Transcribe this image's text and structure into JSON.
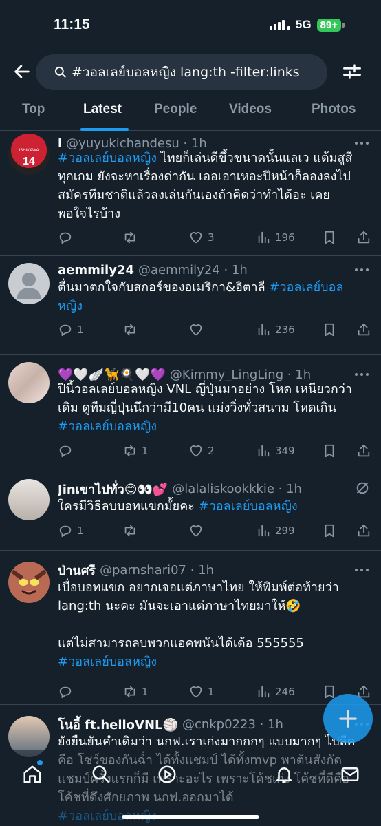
{
  "status_bar": {
    "time": "11:15",
    "network": "5G",
    "battery": "89+"
  },
  "search": {
    "query": "#วอลเลย์บอลหญิง lang:th -filter:links"
  },
  "tabs": [
    "Top",
    "Latest",
    "People",
    "Videos",
    "Photos"
  ],
  "active_tab": "Latest",
  "colors": {
    "background": "#15202b",
    "accent": "#1d9bf0",
    "muted": "#8b98a5",
    "divider": "#38444d"
  },
  "tweets": [
    {
      "name": "i",
      "handle": "@yuyukichandesu · 1h",
      "lines": [
        [
          {
            "t": "#วอลเลย์บอลหญิง",
            "h": true
          },
          {
            "t": " ไทยก็เล่นดีขึ้วขนาดนั้นแลเว แต้มสูสี"
          }
        ],
        [
          {
            "t": "ทุกเกม ยังจะหาเรื่องด่ากัน เออเอาเหอะปีหน้าก็ลองลงไป"
          }
        ],
        [
          {
            "t": "สมัครทีมชาติแล้วลงเล่นกันเองถ้าคิดว่าทำได้อะ เคย"
          }
        ],
        [
          {
            "t": "พอใจไรบ้าง"
          }
        ]
      ],
      "replies": "",
      "retweets": "",
      "likes": "3",
      "views": "196",
      "avatar_jersey": "14",
      "avatar_jersey_name": "ISHIKAWA"
    },
    {
      "name": "aemmily24",
      "handle": "@aemmily24 · 1h",
      "lines": [
        [
          {
            "t": "ตื่นมาตกใจกับสกอร์ของอเมริกา&อิตาลี "
          },
          {
            "t": "#วอลเลย์บอล",
            "h": true
          }
        ],
        [
          {
            "t": "หญิง",
            "h": true
          }
        ]
      ],
      "replies": "1",
      "retweets": "",
      "likes": "",
      "views": "236"
    },
    {
      "name": "💜🤍🪽🦮🍳🤍💜",
      "handle": "@Kimmy_LingLing · 1h",
      "lines": [
        [
          {
            "t": "ปีนี้วอลเลย์บอลหญิง VNL ญี่ปุ่นมาอย่าง โหด เหนียวกว่า"
          }
        ],
        [
          {
            "t": "เดิม ดูทีมญี่ปุ่นนึกว่ามี10คน แม่งวิ่งทั่วสนาม โหดเกิน"
          }
        ],
        [
          {
            "t": "#วอลเลย์บอลหญิง",
            "h": true
          }
        ]
      ],
      "replies": "",
      "retweets": "1",
      "likes": "2",
      "views": "349"
    },
    {
      "name": "Jinเขาไปทั่ว😊👀💕",
      "handle": "@lalaliskookkkie · 1h",
      "lines": [
        [
          {
            "t": "ใครมีวิธีลบบอทแขกมั้ยคะ "
          },
          {
            "t": "#วอลเลย์บอลหญิง",
            "h": true
          }
        ]
      ],
      "replies": "1",
      "retweets": "",
      "likes": "",
      "views": "299"
    },
    {
      "name": "ป่านศรี",
      "handle": "@parnshari07 · 1h",
      "lines": [
        [
          {
            "t": "เบื่อบอทแขก อยากเจอแต่ภาษาไทย ให้พิมพ์ต่อท้ายว่า"
          }
        ],
        [
          {
            "t": "lang:th นะคะ มันจะเอาแต่ภาษาไทยมาให้🤣"
          }
        ],
        [
          {
            "t": " "
          }
        ],
        [
          {
            "t": "แต่ไม่สามารถลบพวกแอคพนันได้เด้อ 555555"
          }
        ],
        [
          {
            "t": "#วอลเลย์บอลหญิง",
            "h": true
          }
        ]
      ],
      "replies": "",
      "retweets": "1",
      "likes": "1",
      "views": "246"
    },
    {
      "name": "โนอี้ ft.helloVNL🏐",
      "handle": "@cnkp0223 · 1h",
      "lines": [
        [
          {
            "t": "ยังยืนยันคำเดิมว่า นกฟ.เราเก่งมากกกๆ แบบมากๆ ไปลีค"
          }
        ],
        [
          {
            "t": "คือ โชว์ของกันฉ่ำ ได้ทั้งแชมป์ ได้ทั้งmvp พาต้นสังกัด"
          }
        ],
        [
          {
            "t": "แชมป์ครั้งแรกก็มี เพราะอะไร เพราะโค้ชเก่ง โค้ชที่ดีคือ"
          }
        ],
        [
          {
            "t": "โค้ชที่ดึงศักยภาพ นกฟ.ออกมาได้"
          }
        ],
        [
          {
            "t": "#วอลเลย์บอลหญิง",
            "h": true
          }
        ]
      ],
      "replies": "",
      "retweets": "",
      "likes": "",
      "views": ""
    }
  ]
}
